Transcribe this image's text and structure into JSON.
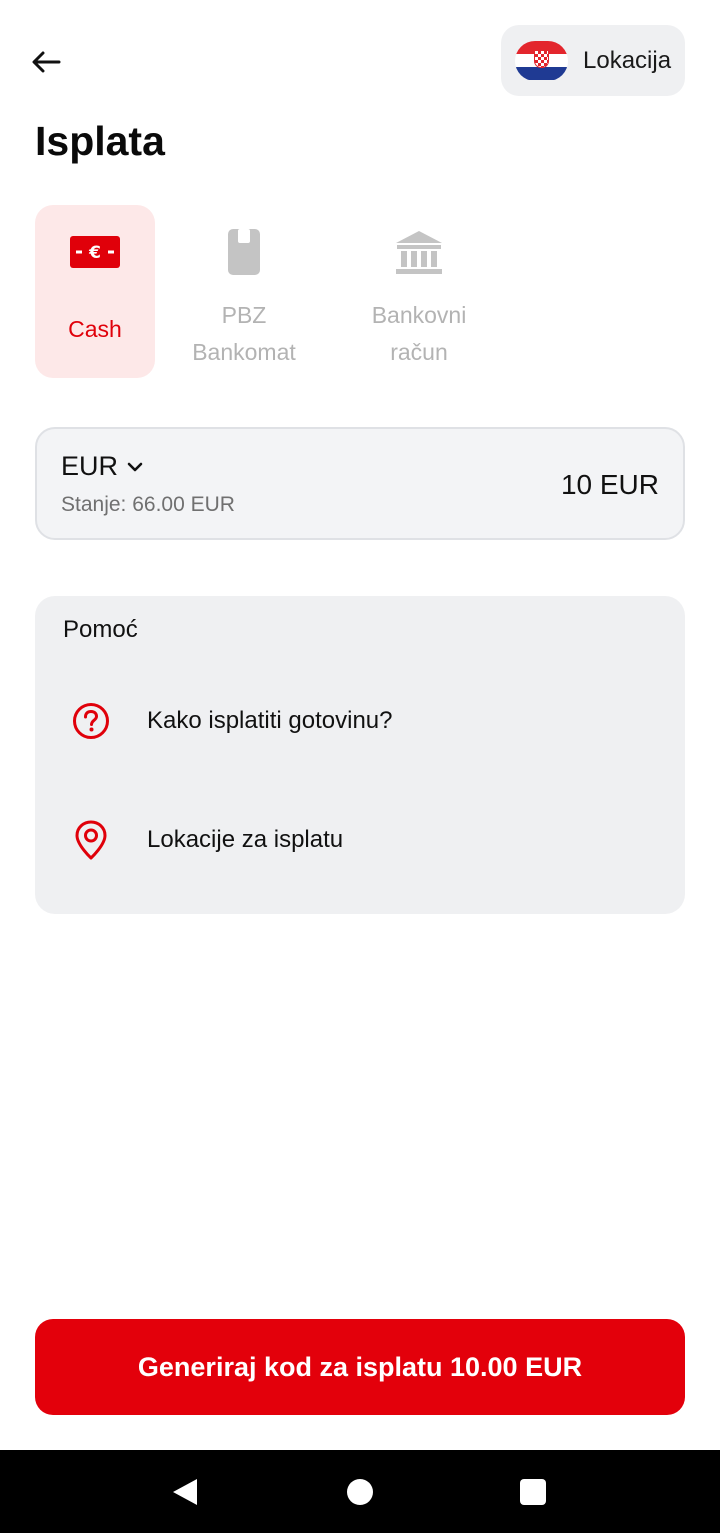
{
  "colors": {
    "brand_red": "#e3000b",
    "cash_tab_bg": "#fde8e8",
    "inactive_gray": "#b3b3b3",
    "panel_bg": "#eff0f2"
  },
  "header": {
    "back_icon": "arrow-left-icon",
    "location_label": "Lokacija",
    "location_flag": "croatia-flag-icon"
  },
  "page_title": "Isplata",
  "methods": [
    {
      "label": "Cash",
      "icon": "cash-euro-icon",
      "selected": true
    },
    {
      "label": "PBZ\nBankomat",
      "icon": "atm-card-icon",
      "selected": false
    },
    {
      "label": "Bankovni\nračun",
      "icon": "bank-building-icon",
      "selected": false
    }
  ],
  "amount": {
    "currency": "EUR",
    "balance": "Stanje: 66.00 EUR",
    "value": "10 EUR"
  },
  "help": {
    "title": "Pomoć",
    "items": [
      {
        "label": "Kako isplatiti gotovinu?",
        "icon": "question-circle-icon"
      },
      {
        "label": "Lokacije za isplatu",
        "icon": "location-pin-icon"
      }
    ]
  },
  "primary_button": "Generiraj kod za isplatu 10.00 EUR",
  "nav": {
    "back_icon": "nav-back-icon",
    "home_icon": "nav-home-icon",
    "recent_icon": "nav-recent-icon"
  }
}
